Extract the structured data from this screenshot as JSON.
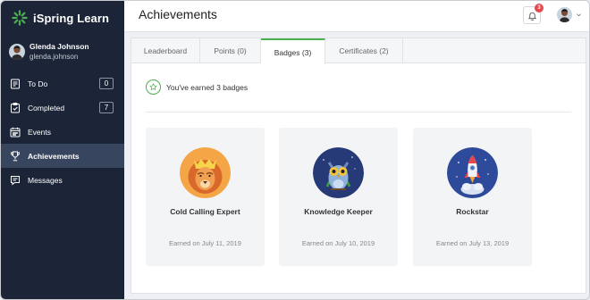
{
  "app": {
    "name": "iSpring Learn"
  },
  "user": {
    "name": "Glenda Johnson",
    "login": "glenda.johnson"
  },
  "nav": [
    {
      "label": "To Do",
      "count": "0",
      "icon": "todo-icon"
    },
    {
      "label": "Completed",
      "count": "7",
      "icon": "completed-icon"
    },
    {
      "label": "Events",
      "count": null,
      "icon": "calendar-icon"
    },
    {
      "label": "Achievements",
      "count": null,
      "icon": "trophy-icon",
      "active": true
    },
    {
      "label": "Messages",
      "count": null,
      "icon": "messages-icon"
    }
  ],
  "header": {
    "title": "Achievements",
    "notifications": "3"
  },
  "tabs": [
    {
      "label": "Leaderboard"
    },
    {
      "label": "Points (0)"
    },
    {
      "label": "Badges (3)",
      "active": true
    },
    {
      "label": "Certificates (2)"
    }
  ],
  "summary": {
    "text": "You've earned 3 badges"
  },
  "badges": [
    {
      "title": "Cold Calling Expert",
      "earned": "Earned on July 11, 2019",
      "icon": "lion-badge-icon"
    },
    {
      "title": "Knowledge Keeper",
      "earned": "Earned on July 10, 2019",
      "icon": "owl-badge-icon"
    },
    {
      "title": "Rockstar",
      "earned": "Earned on July 13, 2019",
      "icon": "rocket-badge-icon"
    }
  ],
  "colors": {
    "sidebar": "#1c2538",
    "sidebar_active": "#37465e",
    "accent": "#4caf50",
    "badge_red": "#e8474c"
  }
}
